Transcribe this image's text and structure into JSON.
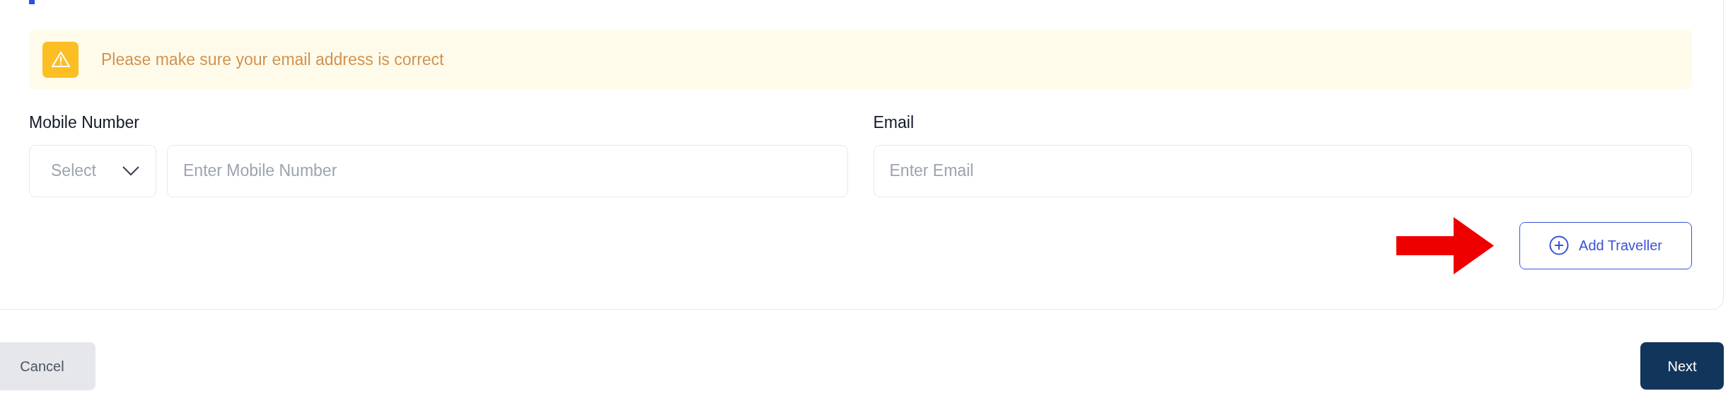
{
  "alert": {
    "kind": "warning",
    "message": "Please make sure your email address is correct"
  },
  "fields": [
    {
      "label": "Mobile Number",
      "kind": "phone",
      "select_placeholder": "Select",
      "placeholder": "Enter Mobile Number"
    },
    {
      "label": "Email",
      "kind": "text",
      "placeholder": "Enter Email"
    }
  ],
  "add_button": "Add Traveller",
  "footer": {
    "cancel": "Cancel",
    "next": "Next"
  }
}
